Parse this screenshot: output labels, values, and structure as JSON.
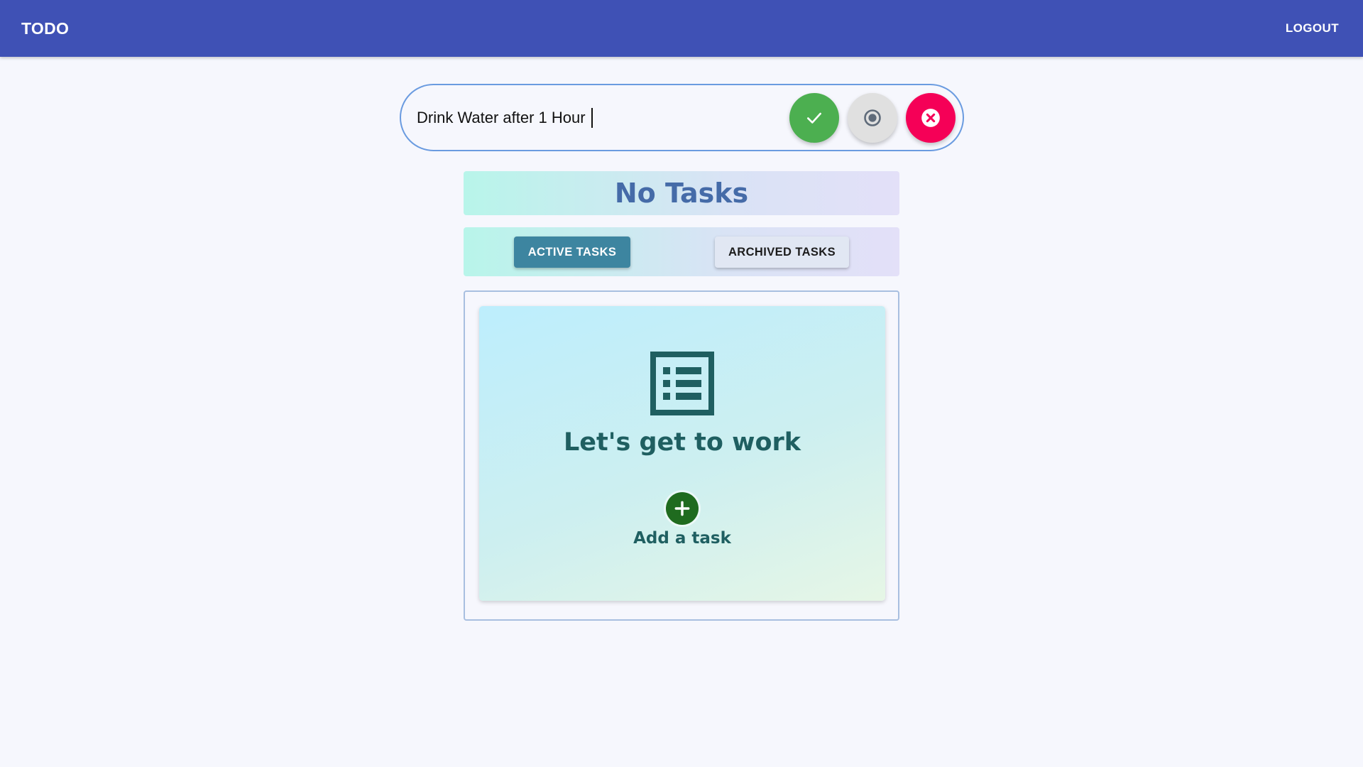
{
  "appbar": {
    "title": "TODO",
    "logout_label": "LOGOUT"
  },
  "task_input": {
    "value": "Drink Water after 1 Hour",
    "actions": {
      "confirm_icon": "check-icon",
      "target_icon": "radio-target-icon",
      "clear_icon": "close-circle-icon"
    }
  },
  "status": {
    "title": "No Tasks"
  },
  "tabs": [
    {
      "label": "ACTIVE TASKS",
      "active": true
    },
    {
      "label": "ARCHIVED TASKS",
      "active": false
    }
  ],
  "empty_state": {
    "icon": "list-icon",
    "title": "Let's get to work",
    "add_icon": "add-circle-icon",
    "add_label": "Add a task"
  },
  "colors": {
    "appbar": "#3f51b5",
    "confirm": "#4caf50",
    "clear": "#f50057",
    "active_tab": "#3d85a0",
    "accent_text": "#1f5f61"
  }
}
